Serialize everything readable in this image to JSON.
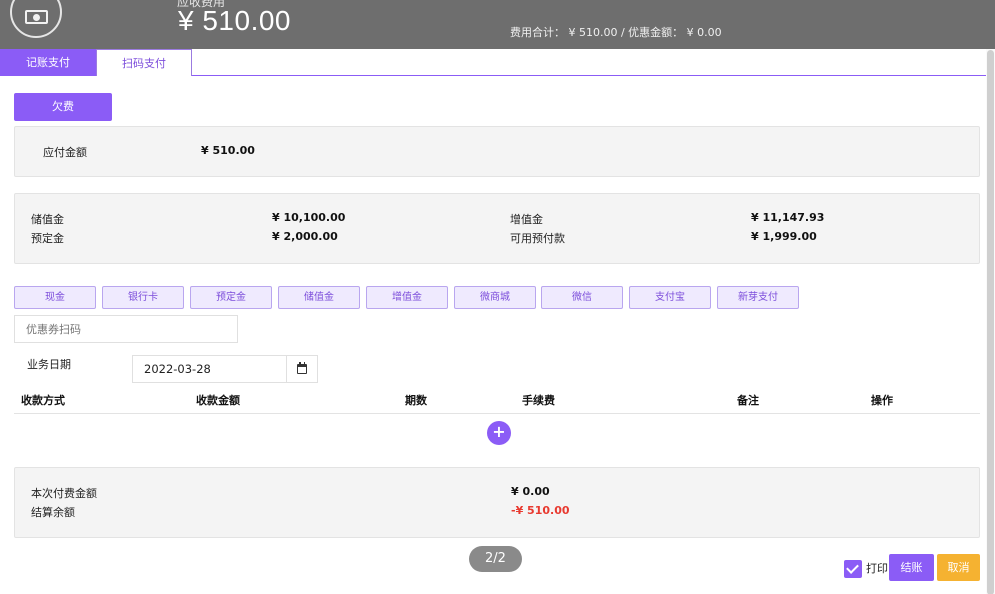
{
  "header": {
    "label": "应收费用",
    "amount": "¥ 510.00",
    "summary": "费用合计： ¥ 510.00 / 优惠金额： ¥ 0.00"
  },
  "tabs": [
    {
      "label": "记账支付",
      "active": true
    },
    {
      "label": "扫码支付",
      "active": false
    }
  ],
  "arrears_button": "欠费",
  "due": {
    "label": "应付金额",
    "value": "¥ 510.00"
  },
  "balances": {
    "stored_value": {
      "label": "储值金",
      "value": "¥ 10,100.00"
    },
    "deposit": {
      "label": "预定金",
      "value": "¥ 2,000.00"
    },
    "bonus_value": {
      "label": "增值金",
      "value": "¥ 11,147.93"
    },
    "available_prepay": {
      "label": "可用预付款",
      "value": "¥ 1,999.00"
    }
  },
  "payment_methods": [
    "现金",
    "银行卡",
    "预定金",
    "储值金",
    "增值金",
    "微商城",
    "微信",
    "支付宝",
    "新芽支付"
  ],
  "coupon": {
    "placeholder": "优惠券扫码"
  },
  "business_date": {
    "label": "业务日期",
    "value": "2022-03-28"
  },
  "table": {
    "headers": [
      "收款方式",
      "收款金额",
      "期数",
      "手续费",
      "备注",
      "操作"
    ]
  },
  "summary": {
    "current_payment": {
      "label": "本次付费金额",
      "value": "¥ 0.00"
    },
    "settlement_balance": {
      "label": "结算余额",
      "value": "-¥ 510.00"
    }
  },
  "pager": "2/2",
  "footer": {
    "print_label": "打印",
    "print_checked": true,
    "settle_label": "结账",
    "cancel_label": "取消"
  },
  "colors": {
    "accent": "#8b5cf6",
    "header_bg": "#6e6e6e",
    "negative": "#e8392f",
    "cancel": "#f5b231"
  }
}
